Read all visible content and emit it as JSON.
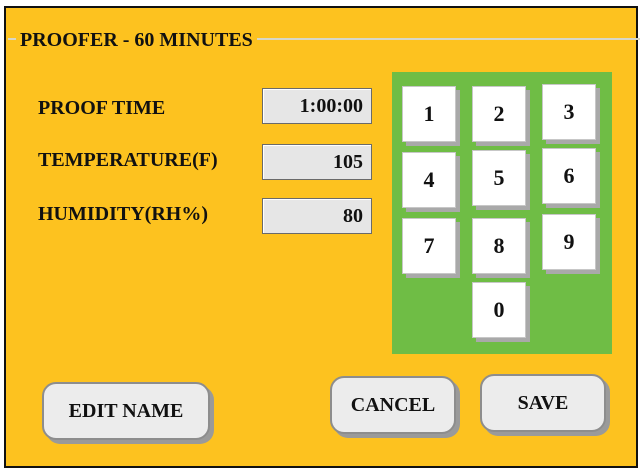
{
  "screen": {
    "title": "PROOFER - 60 MINUTES"
  },
  "fields": [
    {
      "label": "PROOF TIME",
      "value": "1:00:00"
    },
    {
      "label": "TEMPERATURE(F)",
      "value": "105"
    },
    {
      "label": "HUMIDITY(RH%)",
      "value": "80"
    }
  ],
  "keypad": {
    "keys": [
      "1",
      "2",
      "3",
      "4",
      "5",
      "6",
      "7",
      "8",
      "9",
      "0"
    ]
  },
  "buttons": {
    "edit_name": "EDIT NAME",
    "cancel": "CANCEL",
    "save": "SAVE"
  },
  "colors": {
    "background": "#fdc21f",
    "keypad": "#6fbd45",
    "field": "#e6e6e6",
    "button": "#ececec"
  }
}
